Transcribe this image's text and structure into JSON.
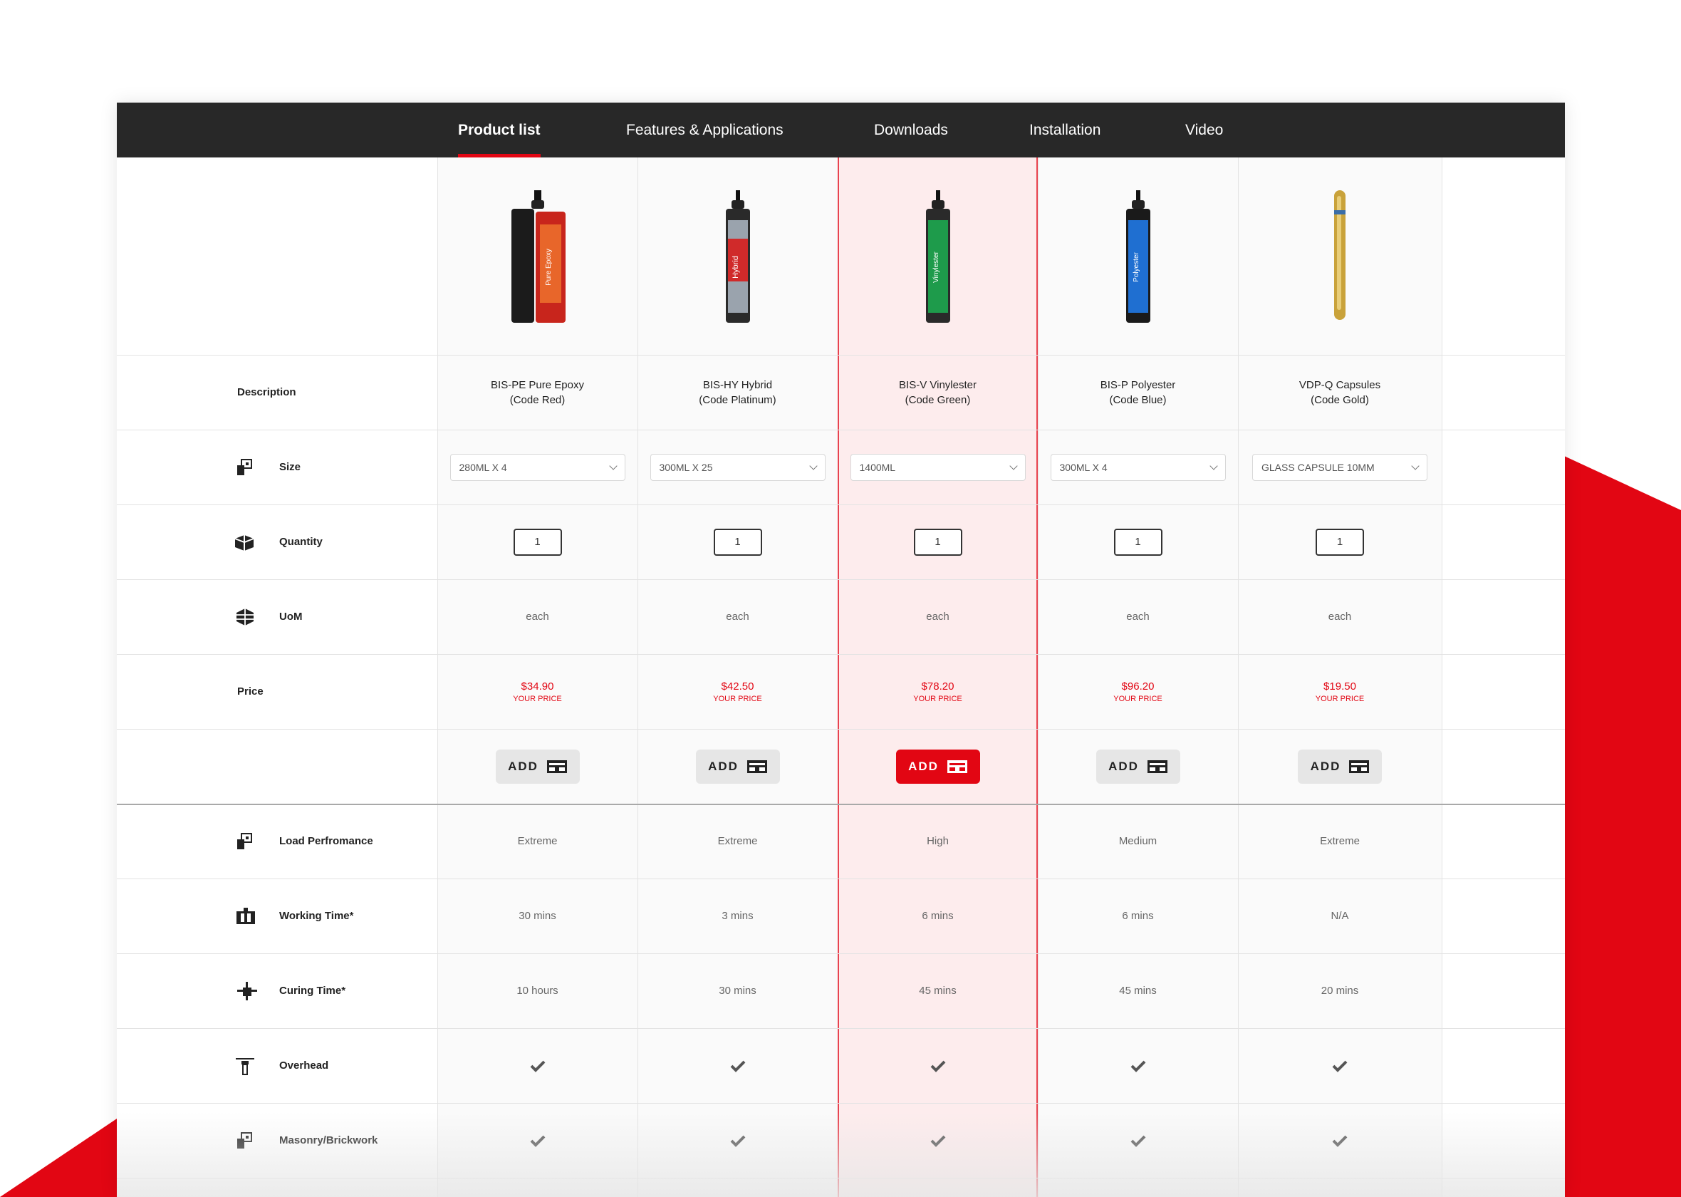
{
  "tabs": [
    {
      "label": "Product list",
      "active": true
    },
    {
      "label": "Features & Applications",
      "active": false
    },
    {
      "label": "Downloads",
      "active": false
    },
    {
      "label": "Installation",
      "active": false
    },
    {
      "label": "Video",
      "active": false
    }
  ],
  "rows": {
    "description": "Description",
    "size": "Size",
    "quantity": "Quantity",
    "uom": "UoM",
    "price": "Price",
    "load": "Load Perfromance",
    "working": "Working Time*",
    "curing": "Curing Time*",
    "overhead": "Overhead",
    "masonry": "Masonry/Brickwork"
  },
  "products": [
    {
      "name": "BIS-PE Pure Epoxy",
      "code": "(Code Red)",
      "size": "280ML X 4",
      "qty": "1",
      "uom": "each",
      "price": "$34.90",
      "price_note": "YOUR PRICE",
      "add": "ADD",
      "load": "Extreme",
      "working": "30 mins",
      "curing": "10 hours",
      "color": "#c8251c",
      "image_label": "Pure Epoxy"
    },
    {
      "name": "BIS-HY Hybrid",
      "code": "(Code Platinum)",
      "size": "300ML X 25",
      "qty": "1",
      "uom": "each",
      "price": "$42.50",
      "price_note": "YOUR PRICE",
      "add": "ADD",
      "load": "Extreme",
      "working": "3 mins",
      "curing": "30 mins",
      "color": "#9aa3ad",
      "image_label": "Hybrid"
    },
    {
      "name": "BIS-V Vinylester",
      "code": "(Code Green)",
      "size": "1400ML",
      "qty": "1",
      "uom": "each",
      "price": "$78.20",
      "price_note": "YOUR PRICE",
      "add": "ADD",
      "load": "High",
      "working": "6 mins",
      "curing": "45 mins",
      "color": "#1e9b4b",
      "image_label": "Vinylester"
    },
    {
      "name": "BIS-P Polyester",
      "code": "(Code Blue)",
      "size": "300ML X 4",
      "qty": "1",
      "uom": "each",
      "price": "$96.20",
      "price_note": "YOUR PRICE",
      "add": "ADD",
      "load": "Medium",
      "working": "6 mins",
      "curing": "45 mins",
      "color": "#1f6fd1",
      "image_label": "Polyester"
    },
    {
      "name": "VDP-Q Capsules",
      "code": "(Code Gold)",
      "size": "GLASS CAPSULE 10MM",
      "qty": "1",
      "uom": "each",
      "price": "$19.50",
      "price_note": "YOUR PRICE",
      "add": "ADD",
      "load": "Extreme",
      "working": "N/A",
      "curing": "20 mins",
      "color": "#c9a23a",
      "image_label": ""
    }
  ],
  "colors": {
    "accent": "#e20613",
    "nav_bg": "#282828",
    "highlight_bg": "#fdeced"
  }
}
